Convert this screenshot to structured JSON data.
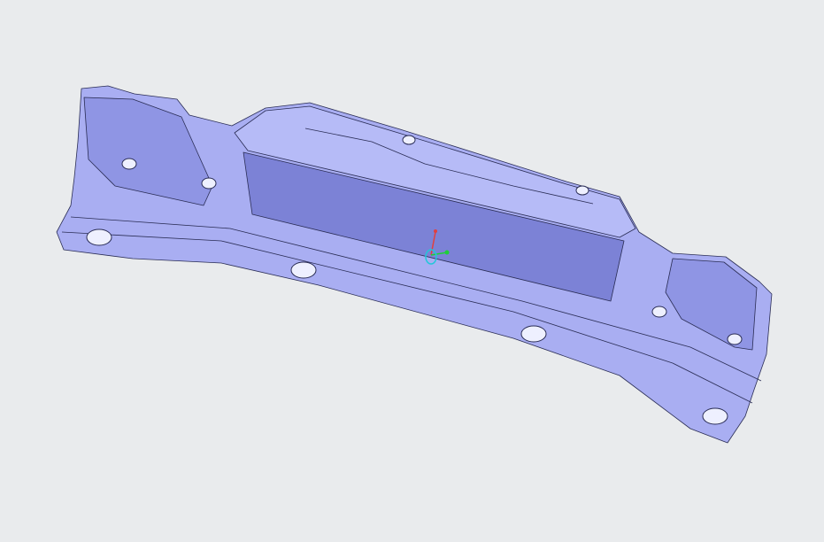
{
  "viewport": {
    "background": "#e9ebed",
    "model": {
      "fill_light": "#b3b8f5",
      "fill_mid": "#9ea4ec",
      "fill_dark": "#7c82d6",
      "edge": "#2a2d55"
    },
    "triad": {
      "icon": "axis-triad-icon",
      "x_color": "#1fcf3a",
      "y_color": "#e04040",
      "z_color": "#20c8d8"
    }
  }
}
